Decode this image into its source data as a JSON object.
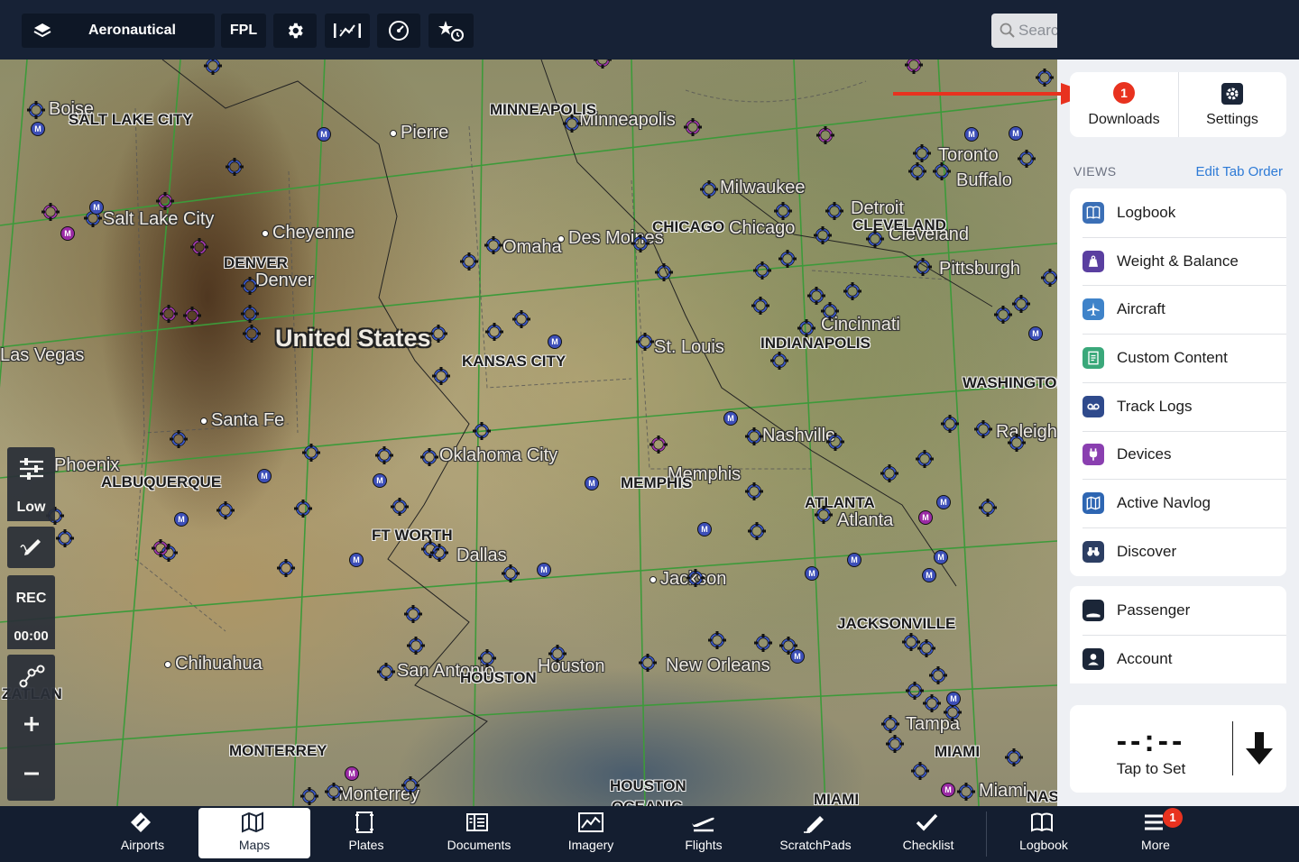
{
  "topbar": {
    "layers_icon": "layers-icon",
    "map_mode_label": "Aeronautical",
    "fpl_label": "FPL",
    "search_placeholder": "Search"
  },
  "map": {
    "country": "United States",
    "cities": [
      "Boise",
      "Pierre",
      "Minneapolis",
      "Salt Lake City",
      "Cheyenne",
      "Denver",
      "Omaha",
      "Des Moines",
      "Chicago",
      "Milwaukee",
      "Detroit",
      "Cleveland",
      "Toronto",
      "Buffalo",
      "Pittsburgh",
      "Cincinnati",
      "St. Louis",
      "Las Vegas",
      "Santa Fe",
      "Nashville",
      "Raleigh",
      "Phoenix",
      "Oklahoma City",
      "Memphis",
      "Atlanta",
      "Dallas",
      "Jackson",
      "San Antonio",
      "Houston",
      "New Orleans",
      "Tampa",
      "Chihuahua",
      "Monterrey",
      "Miami"
    ],
    "regions": [
      "SALT LAKE CITY",
      "MINNEAPOLIS",
      "DENVER",
      "CHICAGO",
      "CLEVELAND",
      "KANSAS CITY",
      "INDIANAPOLIS",
      "WASHINGTON",
      "ALBUQUERQUE",
      "MEMPHIS",
      "ATLANTA",
      "FT WORTH",
      "JACKSONVILLE",
      "HOUSTON",
      "ZATLAN",
      "MONTERREY",
      "MIAMI",
      "HOUSTON",
      "OCEANIC",
      "MIAMI",
      "NAS"
    ]
  },
  "left_controls": {
    "altitude_label": "Low",
    "rec_label": "REC",
    "timer": "00:00"
  },
  "panel": {
    "downloads_label": "Downloads",
    "downloads_badge": "1",
    "settings_label": "Settings",
    "views_label": "VIEWS",
    "edit_tab_order": "Edit Tab Order",
    "views": [
      {
        "label": "Logbook",
        "icon": "logbook-icon",
        "color": "#3b6fb6"
      },
      {
        "label": "Weight & Balance",
        "icon": "weight-icon",
        "color": "#5a3fa0"
      },
      {
        "label": "Aircraft",
        "icon": "airplane-icon",
        "color": "#3f83c9"
      },
      {
        "label": "Custom Content",
        "icon": "document-icon",
        "color": "#3aa87a"
      },
      {
        "label": "Track Logs",
        "icon": "tracklog-icon",
        "color": "#2f4a8c"
      },
      {
        "label": "Devices",
        "icon": "plug-icon",
        "color": "#8a3fb0"
      },
      {
        "label": "Active Navlog",
        "icon": "map-book-icon",
        "color": "#2e66b2"
      },
      {
        "label": "Discover",
        "icon": "binoculars-icon",
        "color": "#2c3e63"
      }
    ],
    "account_items": [
      {
        "label": "Passenger",
        "icon": "passenger-icon",
        "color": "#1b2638"
      },
      {
        "label": "Account",
        "icon": "account-icon",
        "color": "#1b2638"
      }
    ],
    "tap_to_set": "Tap to Set",
    "tap_value": "--:--"
  },
  "tabs": [
    {
      "label": "Airports",
      "icon": "airports-icon",
      "active": false
    },
    {
      "label": "Maps",
      "icon": "maps-icon",
      "active": true
    },
    {
      "label": "Plates",
      "icon": "plates-icon",
      "active": false
    },
    {
      "label": "Documents",
      "icon": "documents-icon",
      "active": false
    },
    {
      "label": "Imagery",
      "icon": "imagery-icon",
      "active": false
    },
    {
      "label": "Flights",
      "icon": "flights-icon",
      "active": false
    },
    {
      "label": "ScratchPads",
      "icon": "scratchpads-icon",
      "active": false
    },
    {
      "label": "Checklist",
      "icon": "checklist-icon",
      "active": false
    },
    {
      "label": "Logbook",
      "icon": "logbook-icon",
      "active": false
    },
    {
      "label": "More",
      "icon": "more-icon",
      "active": false,
      "badge": "1"
    }
  ]
}
